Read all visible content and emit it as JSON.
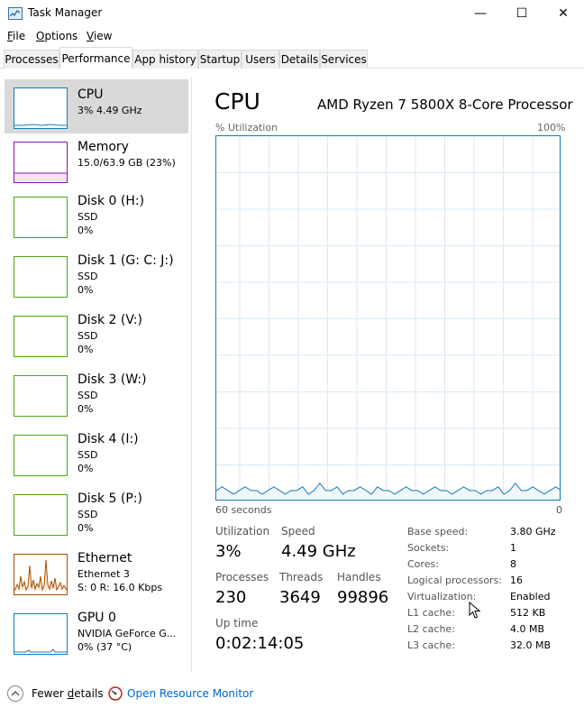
{
  "window": {
    "title": "Task Manager",
    "minimize_glyph": "—",
    "maximize_glyph": "☐",
    "close_glyph": "✕"
  },
  "menu": {
    "file": {
      "accel": "F",
      "rest": "ile"
    },
    "options": {
      "accel": "O",
      "rest": "ptions"
    },
    "view": {
      "accel": "V",
      "rest": "iew"
    }
  },
  "tabs": {
    "processes": "Processes",
    "performance": "Performance",
    "app_history": "App history",
    "startup": "Startup",
    "users": "Users",
    "details": "Details",
    "services": "Services"
  },
  "sidebar": {
    "cpu": {
      "title": "CPU",
      "sub1": "3%  4.49 GHz"
    },
    "memory": {
      "title": "Memory",
      "sub1": "15.0/63.9 GB (23%)"
    },
    "disk0": {
      "title": "Disk 0 (H:)",
      "sub1": "SSD",
      "sub2": "0%"
    },
    "disk1": {
      "title": "Disk 1 (G: C: J:)",
      "sub1": "SSD",
      "sub2": "0%"
    },
    "disk2": {
      "title": "Disk 2 (V:)",
      "sub1": "SSD",
      "sub2": "0%"
    },
    "disk3": {
      "title": "Disk 3 (W:)",
      "sub1": "SSD",
      "sub2": "0%"
    },
    "disk4": {
      "title": "Disk 4 (I:)",
      "sub1": "SSD",
      "sub2": "0%"
    },
    "disk5": {
      "title": "Disk 5 (P:)",
      "sub1": "SSD",
      "sub2": "0%"
    },
    "ethernet": {
      "title": "Ethernet",
      "sub1": "Ethernet 3",
      "sub2": "S: 0  R: 16.0 Kbps"
    },
    "gpu0": {
      "title": "GPU 0",
      "sub1": "NVIDIA GeForce G...",
      "sub2": "0%  (37 °C)"
    }
  },
  "main": {
    "title": "CPU",
    "model": "AMD Ryzen 7 5800X 8-Core Processor",
    "util_label": "% Utilization",
    "util_max": "100%",
    "time_left": "60 seconds",
    "time_right": "0",
    "stats": {
      "utilization_label": "Utilization",
      "utilization_value": "3%",
      "speed_label": "Speed",
      "speed_value": "4.49 GHz",
      "processes_label": "Processes",
      "processes_value": "230",
      "threads_label": "Threads",
      "threads_value": "3649",
      "handles_label": "Handles",
      "handles_value": "99896",
      "uptime_label": "Up time",
      "uptime_value": "0:02:14:05"
    },
    "specs": {
      "base_speed_label": "Base speed:",
      "base_speed_value": "3.80 GHz",
      "sockets_label": "Sockets:",
      "sockets_value": "1",
      "cores_label": "Cores:",
      "cores_value": "8",
      "logical_label": "Logical processors:",
      "logical_value": "16",
      "virt_label": "Virtualization:",
      "virt_value": "Enabled",
      "l1_label": "L1 cache:",
      "l1_value": "512 KB",
      "l2_label": "L2 cache:",
      "l2_value": "4.0 MB",
      "l3_label": "L3 cache:",
      "l3_value": "32.0 MB"
    }
  },
  "footer": {
    "fewer_accel": "d",
    "fewer_before": "Fewer ",
    "fewer_after": "etails",
    "resmon": "Open Resource Monitor"
  },
  "colors": {
    "cpu": "#117dbb",
    "memory": "#8b12ae",
    "disk": "#4da60c",
    "ethernet": "#a74f01",
    "gpu": "#117dbb",
    "grid": "#d9eaf4",
    "link": "#0066cc"
  },
  "graph_utilization_series_pct": [
    3,
    4,
    3,
    2,
    3,
    4,
    3,
    3,
    2,
    3,
    4,
    3,
    2,
    3,
    3,
    4,
    2,
    3,
    5,
    3,
    3,
    4,
    2,
    3,
    3,
    4,
    3,
    2,
    4,
    3,
    3,
    2,
    3,
    4,
    3,
    3,
    2,
    3,
    4,
    3,
    3,
    2,
    3,
    4,
    3,
    3,
    2,
    3,
    3,
    4,
    2,
    3,
    5,
    3,
    3,
    4,
    3,
    2,
    3,
    4,
    3
  ]
}
